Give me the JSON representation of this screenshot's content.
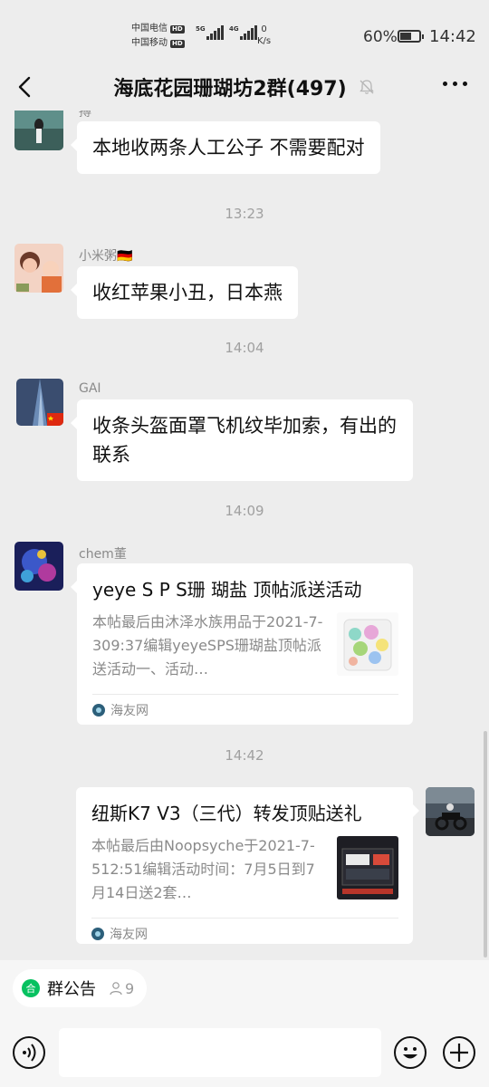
{
  "status_bar": {
    "carrier_1": "中国电信",
    "carrier_2": "中国移动",
    "hd_badge": "HD",
    "net_1": "5G",
    "net_2": "4G",
    "speed_value": "0",
    "speed_unit": "K/s",
    "battery_percent": "60%",
    "battery_level": 0.6,
    "time": "14:42"
  },
  "nav": {
    "title": "海底花园珊瑚坊2群(497)"
  },
  "messages": [
    {
      "sender": "搏",
      "text": "本地收两条人工公子 不需要配对"
    },
    {
      "time": "13:23"
    },
    {
      "sender": "小米粥🇩🇪",
      "text": "收红苹果小丑，日本燕"
    },
    {
      "time": "14:04"
    },
    {
      "sender": "GAI",
      "text": "收条头盔面罩飞机纹毕加索，有出的联系"
    },
    {
      "time": "14:09"
    },
    {
      "sender": "chem董",
      "card": {
        "title": "yeye S P S珊 瑚盐 顶帖派送活动",
        "desc": "本帖最后由沐泽水族用品于2021-7-309:37编辑yeyeSPS珊瑚盐顶帖派送活动一、活动…",
        "source": "海友网"
      }
    },
    {
      "time": "14:42"
    },
    {
      "card": {
        "title": "纽斯K7 V3（三代）转发顶贴送礼",
        "desc": "本帖最后由Noopsyche于2021-7-512:51编辑活动时间：7月5日到7月14日送2套…",
        "source": "海友网"
      }
    }
  ],
  "notice": {
    "label": "群公告",
    "icon_glyph": "合",
    "count": "9"
  },
  "icons": {
    "back": "back-arrow-icon",
    "mute": "bell-muted-icon",
    "more": "more-dots-icon",
    "voice": "voice-icon",
    "emoji": "emoji-icon",
    "plus": "plus-icon"
  },
  "colors": {
    "background": "#ededed",
    "bubble": "#ffffff",
    "accent_green": "#07c160",
    "time_text": "#a0a0a0"
  }
}
